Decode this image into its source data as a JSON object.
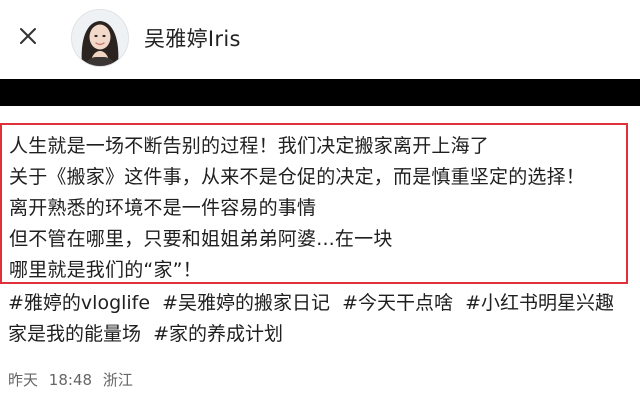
{
  "header": {
    "username": "吴雅婷Iris",
    "close_icon": "close-icon",
    "avatar_icon": "avatar"
  },
  "post": {
    "lines": [
      "人生就是一场不断告别的过程！我们决定搬家离开上海了",
      "关于《搬家》这件事，从来不是仓促的决定，而是慎重坚定的选择！",
      "离开熟悉的环境不是一件容易的事情",
      "但不管在哪里，只要和姐姐弟弟阿婆...在一块",
      "哪里就是我们的“家”！"
    ],
    "highlight_color": "#e0303a"
  },
  "tags": {
    "line1": [
      "#雅婷的vloglife",
      "#吴雅婷的搬家日记",
      "#今天干点啥",
      "#小红书明星兴趣"
    ],
    "line2": [
      "家是我的能量场",
      "#家的养成计划"
    ]
  },
  "meta": {
    "date": "昨天",
    "time": "18:48",
    "location": "浙江"
  }
}
